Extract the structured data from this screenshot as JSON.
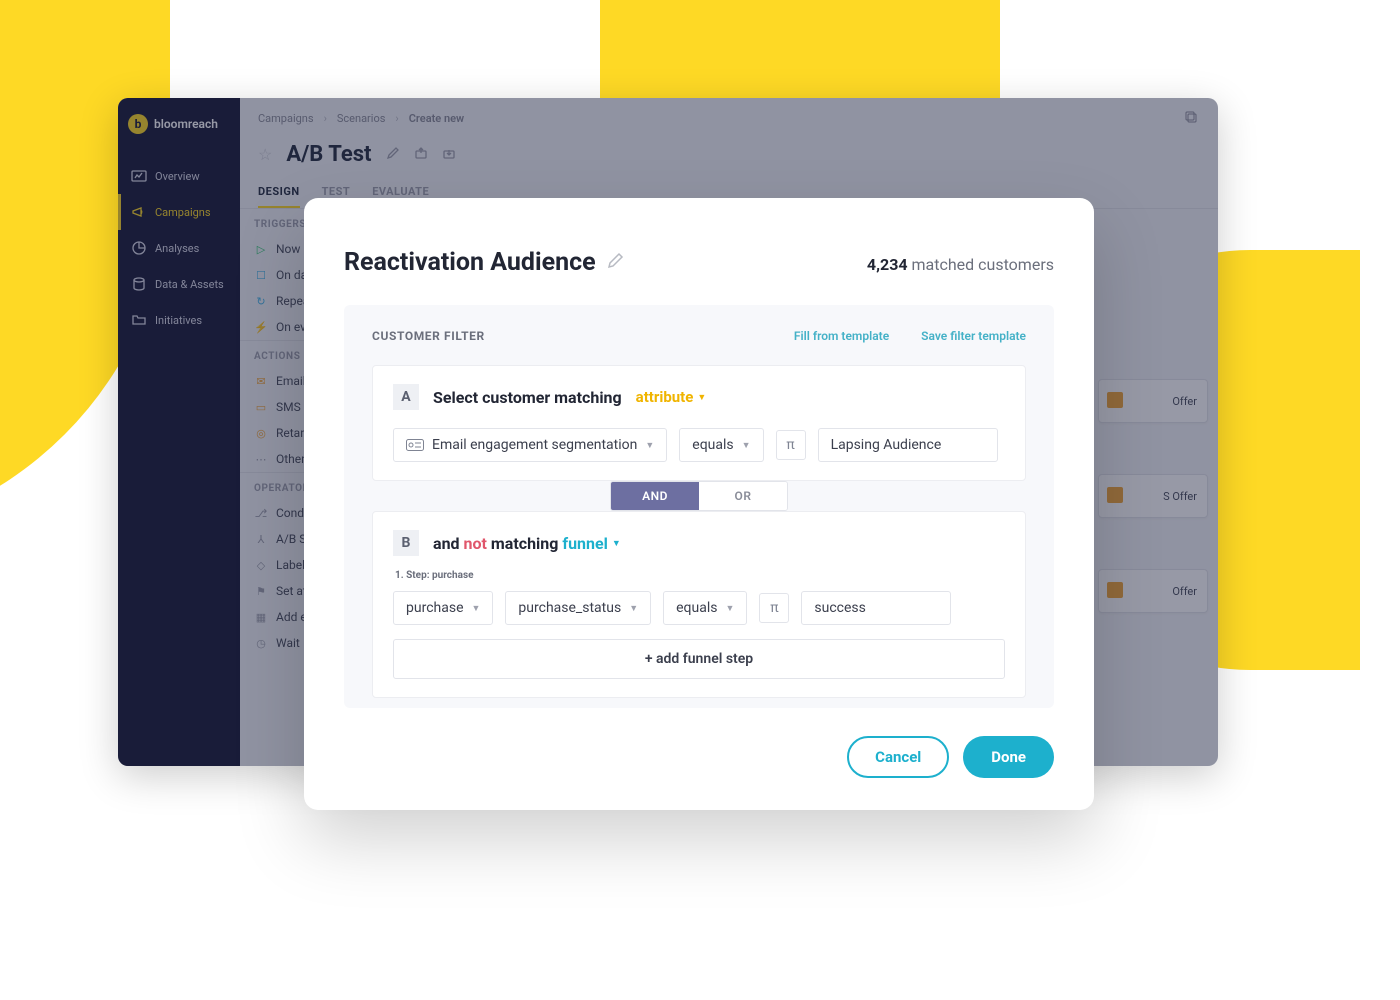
{
  "brand": {
    "name": "bloomreach",
    "glyph": "b"
  },
  "sidebar": {
    "items": [
      {
        "label": "Overview",
        "icon": "gauge-icon"
      },
      {
        "label": "Campaigns",
        "icon": "megaphone-icon",
        "active": true
      },
      {
        "label": "Analyses",
        "icon": "pie-icon"
      },
      {
        "label": "Data & Assets",
        "icon": "database-icon"
      },
      {
        "label": "Initiatives",
        "icon": "folder-icon"
      }
    ]
  },
  "breadcrumbs": {
    "a": "Campaigns",
    "b": "Scenarios",
    "c": "Create new"
  },
  "page_title": "A/B Test",
  "tabs": {
    "design": "DESIGN",
    "test": "TEST",
    "evaluate": "EVALUATE"
  },
  "panel": {
    "triggers_label": "TRIGGERS",
    "triggers": [
      {
        "icon": "play-icon",
        "cls": "pi-green",
        "label": "Now"
      },
      {
        "icon": "cal-icon",
        "cls": "pi-blue",
        "label": "On date"
      },
      {
        "icon": "repeat-icon",
        "cls": "pi-blue",
        "label": "Repeat"
      },
      {
        "icon": "bolt-icon",
        "cls": "pi-green",
        "label": "On event"
      }
    ],
    "actions_label": "ACTIONS",
    "actions": [
      {
        "icon": "mail-icon",
        "cls": "pi-orange",
        "label": "Email"
      },
      {
        "icon": "phone-icon",
        "cls": "pi-orange",
        "label": "SMS"
      },
      {
        "icon": "target-icon",
        "cls": "pi-orange",
        "label": "Retargeting"
      },
      {
        "icon": "dots-icon",
        "cls": "pi-grey",
        "label": "Other"
      }
    ],
    "operators_label": "OPERATORS",
    "operators": [
      {
        "icon": "branch-icon",
        "cls": "pi-grey",
        "label": "Condition"
      },
      {
        "icon": "split-icon",
        "cls": "pi-grey",
        "label": "A/B Split"
      },
      {
        "icon": "tag-icon",
        "cls": "pi-grey",
        "label": "Label"
      },
      {
        "icon": "flag-icon",
        "cls": "pi-grey",
        "label": "Set attribute"
      },
      {
        "icon": "plus-icon",
        "cls": "pi-grey",
        "label": "Add event"
      },
      {
        "icon": "clock-icon",
        "cls": "pi-grey",
        "label": "Wait"
      }
    ]
  },
  "canvas": {
    "cards": [
      {
        "label": "Offer"
      },
      {
        "label": "S Offer"
      },
      {
        "label": "Offer"
      }
    ]
  },
  "modal": {
    "title": "Reactivation Audience",
    "matched_count": "4,234",
    "matched_suffix": "matched customers",
    "filter_heading": "CUSTOMER FILTER",
    "fill_link": "Fill from template",
    "save_link": "Save filter template",
    "ruleA": {
      "badge": "A",
      "prompt": "Select customer matching",
      "type_label": "attribute",
      "attr_chip": "Email engagement segmentation",
      "op_chip": "equals",
      "value_chip": "Lapsing Audience"
    },
    "andor": {
      "and": "AND",
      "or": "OR"
    },
    "ruleB": {
      "badge": "B",
      "and": "and",
      "not": "not",
      "matching": "matching",
      "funnel": "funnel",
      "step_label": "1. Step: purchase",
      "event_chip": "purchase",
      "field_chip": "purchase_status",
      "op_chip": "equals",
      "value_chip": "success"
    },
    "add_step": "+ add funnel step",
    "cancel": "Cancel",
    "done": "Done"
  }
}
